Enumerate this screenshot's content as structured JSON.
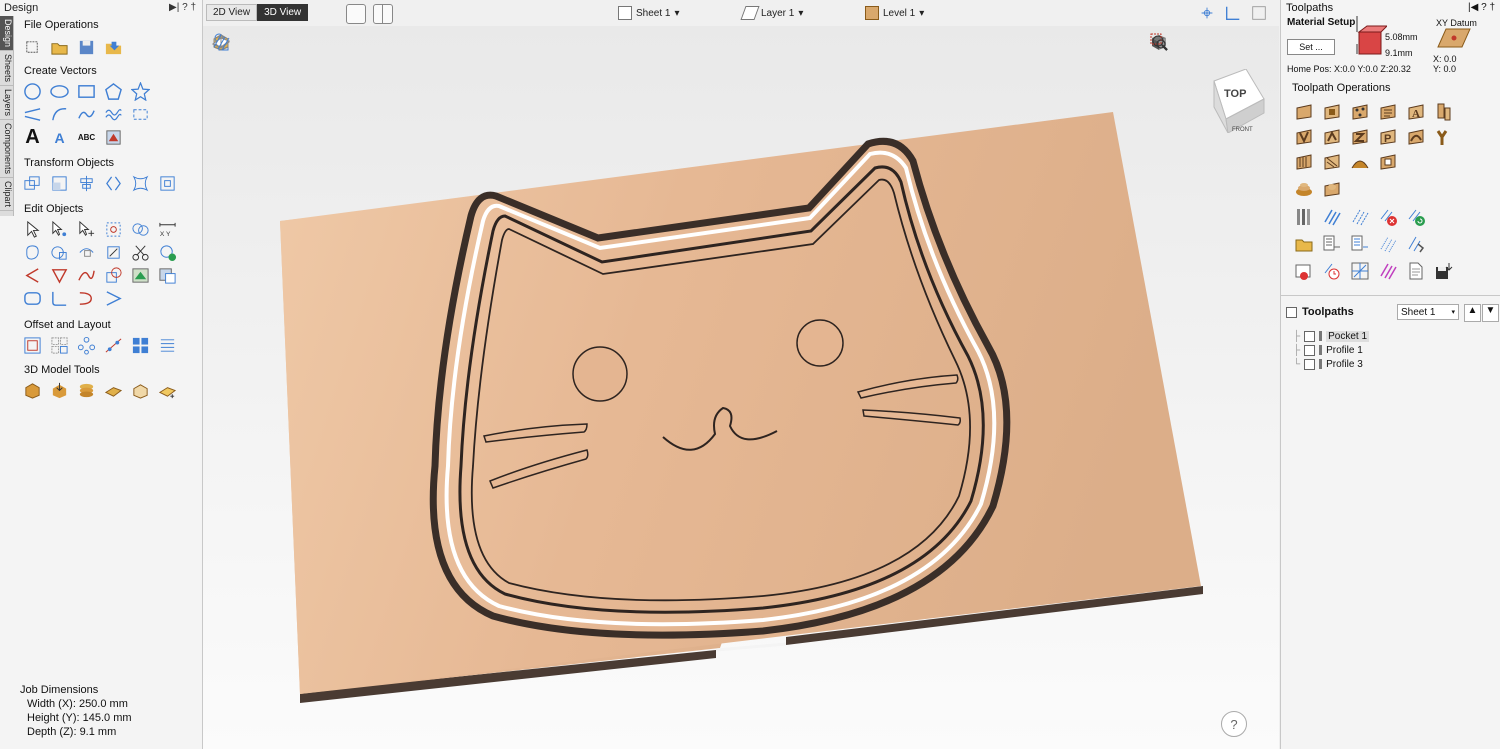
{
  "left_panel": {
    "title": "Design",
    "header_icons": [
      "▶|",
      "?",
      "†"
    ],
    "vertical_tabs": [
      "Design",
      "Sheets",
      "Layers",
      "Components",
      "Clipart"
    ],
    "sections": {
      "file_operations": "File Operations",
      "create_vectors": "Create Vectors",
      "transform_objects": "Transform Objects",
      "edit_objects": "Edit Objects",
      "offset_layout": "Offset and Layout",
      "model_tools": "3D Model Tools"
    },
    "create_vectors_text_glyphs": [
      "A",
      "A",
      "ABC"
    ],
    "edit_xy_label": "X Y",
    "job_dimensions": {
      "title": "Job Dimensions",
      "width": "Width  (X): 250.0 mm",
      "height": "Height (Y): 145.0 mm",
      "depth": "Depth  (Z): 9.1 mm"
    }
  },
  "top_bar": {
    "tab_2d": "2D View",
    "tab_3d": "3D View",
    "sheet": "Sheet 1",
    "layer": "Layer 1",
    "level": "Level 1"
  },
  "viewport": {
    "cube_top": "TOP",
    "cube_front": "FRONT",
    "help": "?"
  },
  "right_panel": {
    "title": "Toolpaths",
    "header_icons": [
      "|◀",
      "?",
      "†"
    ],
    "material_setup": "Material Setup",
    "set_button": "Set ...",
    "z_top": "5.08mm",
    "z_bottom": "9.1mm",
    "xy_datum": "XY Datum",
    "home_pos": "Home Pos:  X:0.0 Y:0.0 Z:20.32",
    "x_val": "X: 0.0",
    "y_val": "Y: 0.0",
    "operations_title": "Toolpath Operations",
    "toolpaths_label": "Toolpaths",
    "sheet_select": "Sheet 1",
    "toolpaths": [
      "Pocket 1",
      "Profile 1",
      "Profile 3"
    ]
  },
  "colors": {
    "wood": "#e6b894",
    "wood_edge": "#4a3b33",
    "accent": "#3f7fd4"
  }
}
